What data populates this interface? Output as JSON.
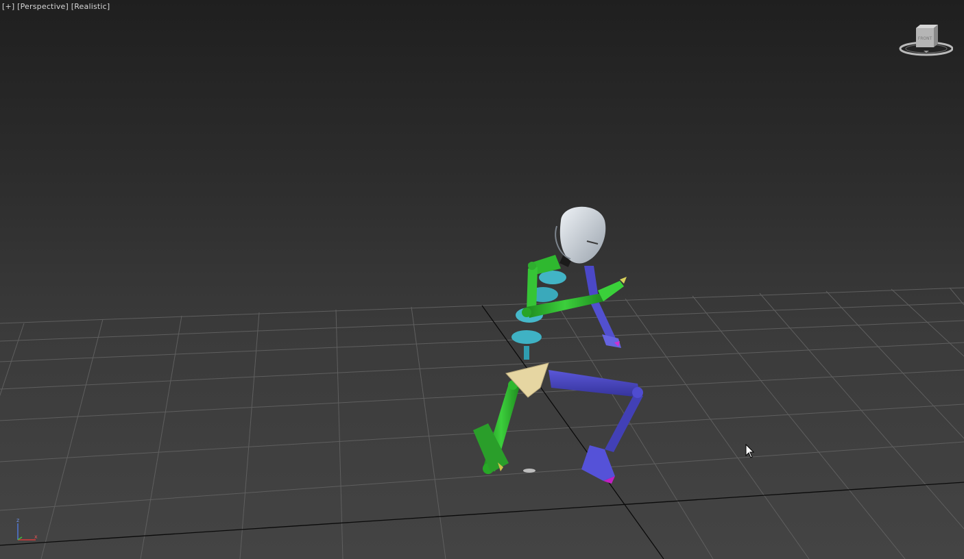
{
  "viewport": {
    "labels": {
      "plus": "[+]",
      "view": "[Perspective]",
      "shading": "[Realistic]"
    },
    "viewcube": {
      "face_label": "FRONT"
    },
    "axis_tripod": {
      "z_label": "z",
      "x_label": "x"
    }
  },
  "colors": {
    "grid": "#5f5f5f",
    "grid_axis": "#0a0a0a",
    "biped_left": "#2fae2f",
    "biped_right": "#4b48c8",
    "spine": "#3fb2c4",
    "head": "#c9cfd6",
    "pelvis": "#e2d3a0"
  }
}
